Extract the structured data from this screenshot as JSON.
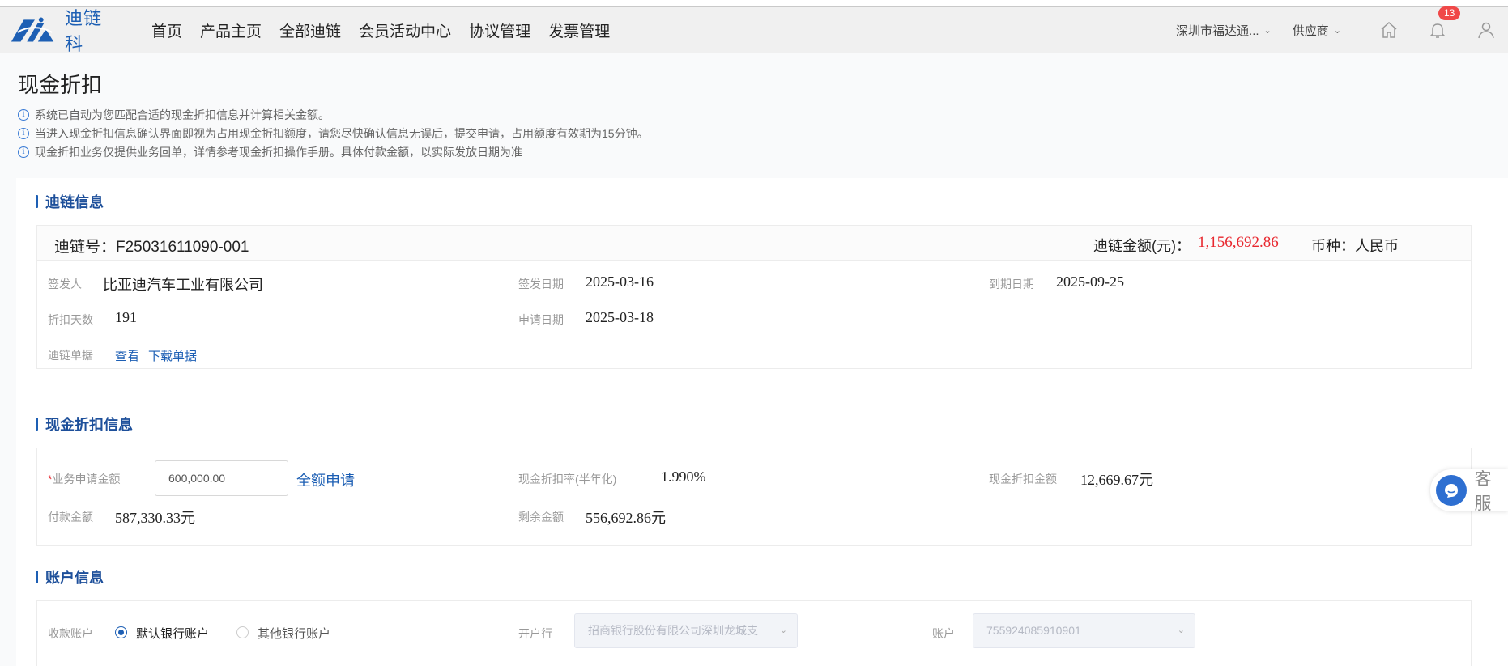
{
  "app": {
    "logo_text": "迪链科"
  },
  "nav": {
    "items": [
      "首页",
      "产品主页",
      "全部迪链",
      "会员活动中心",
      "协议管理",
      "发票管理"
    ]
  },
  "header": {
    "company": "深圳市福达通...",
    "role": "供应商",
    "notification_count": "13"
  },
  "page": {
    "title": "现金折扣",
    "notes": [
      "系统已自动为您匹配合适的现金折扣信息并计算相关金额。",
      "当进入现金折扣信息确认界面即视为占用现金折扣额度，请您尽快确认信息无误后，提交申请，占用额度有效期为15分钟。",
      "现金折扣业务仅提供业务回单，详情参考现金折扣操作手册。具体付款金额，以实际发放日期为准"
    ]
  },
  "chain_info": {
    "section_title": "迪链信息",
    "chain_no": "迪链号：F25031611090-001",
    "amount_label": "迪链金额(元)：",
    "amount": "1,156,692.86",
    "currency": "币种：人民币",
    "issuer_label": "签发人",
    "issuer": "比亚迪汽车工业有限公司",
    "issue_date_label": "签发日期",
    "issue_date": "2025-03-16",
    "due_date_label": "到期日期",
    "due_date": "2025-09-25",
    "discount_days_label": "折扣天数",
    "discount_days": "191",
    "apply_date_label": "申请日期",
    "apply_date": "2025-03-18",
    "document_label": "迪链单据",
    "view_link": "查看",
    "download_link": "下载单据"
  },
  "discount_info": {
    "section_title": "现金折扣信息",
    "required_mark": "*",
    "apply_amount_label": "业务申请金额",
    "apply_amount_value": "600,000.00",
    "full_apply_link": "全额申请",
    "rate_label": "现金折扣率(半年化)",
    "rate": "1.990%",
    "discount_amount_label": "现金折扣金额",
    "discount_amount": "12,669.67元",
    "payment_label": "付款金额",
    "payment": "587,330.33元",
    "remaining_label": "剩余金额",
    "remaining": "556,692.86元"
  },
  "account_info": {
    "section_title": "账户信息",
    "receive_label": "收款账户",
    "default_account": "默认银行账户",
    "other_account": "其他银行账户",
    "bank_label": "开户行",
    "bank_value": "招商银行股份有限公司深圳龙城支",
    "account_label": "账户",
    "account_value": "755924085910901"
  },
  "customer_service": {
    "label": "客服"
  },
  "colors": {
    "brand": "#1d5fb4",
    "amount_red": "#e8272e",
    "badge_red": "#f04848"
  }
}
